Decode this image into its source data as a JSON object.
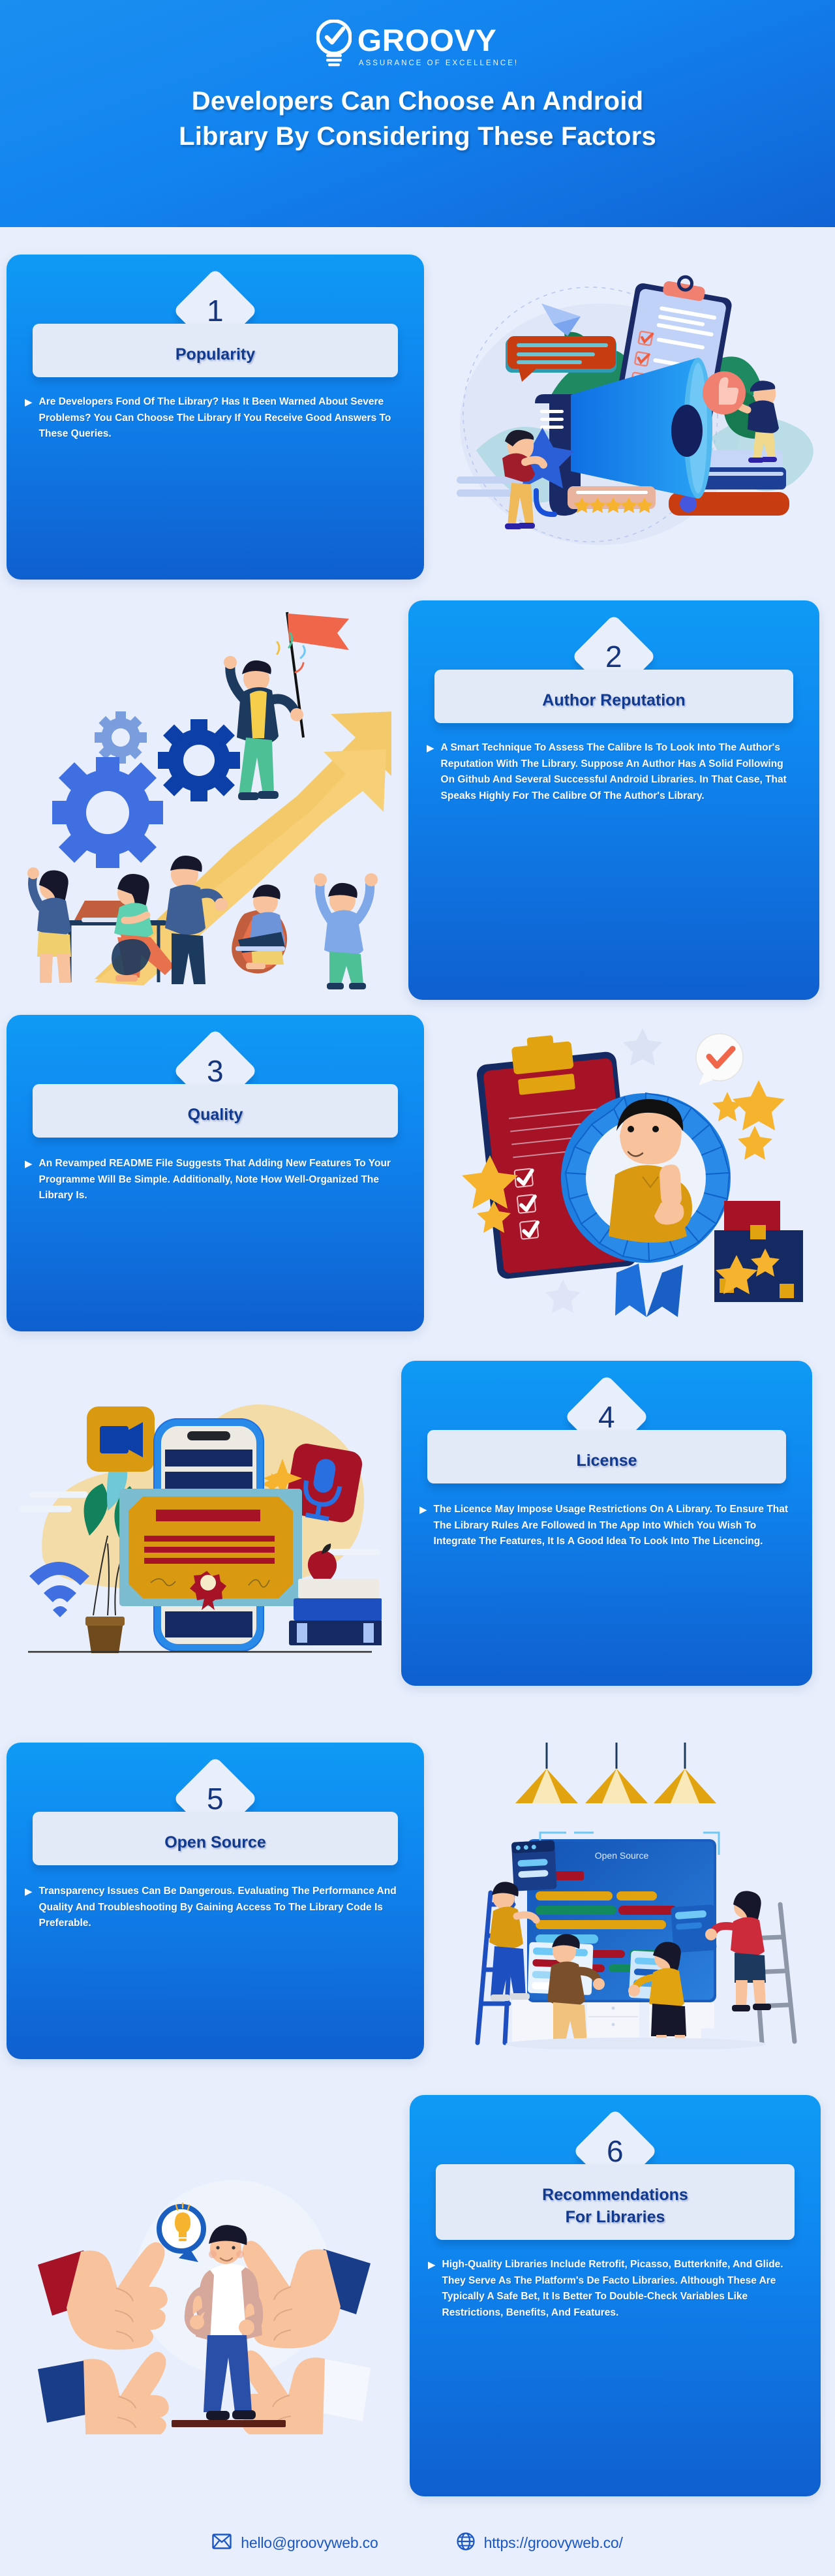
{
  "brand": {
    "logo_name": "GROOVY",
    "logo_tagline": "ASSURANCE OF EXCELLENCE!",
    "logo_icon": "lightbulb-check-icon",
    "accent_blue": "#0f86ef",
    "deep_blue": "#11398e",
    "page_bg": "#e8eefb"
  },
  "header": {
    "title_line1": "Developers Can Choose An Android",
    "title_line2": "Library By Considering These Factors"
  },
  "cards": [
    {
      "number": "1",
      "title": "Popularity",
      "title_line2": "",
      "body": "Are Developers Fond Of The Library? Has It Been Warned About Severe Problems? You Can Choose The Library If You Receive Good Answers To These Queries.",
      "bullet": "▶",
      "illustration": "megaphone-reviews-illustration",
      "side": "left"
    },
    {
      "number": "2",
      "title": "Author Reputation",
      "title_line2": "",
      "body": "A Smart Technique To Assess The Calibre Is To Look Into The Author's Reputation With The Library. Suppose An Author Has A Solid Following On Github And Several Successful Android Libraries. In That Case, That Speaks Highly For The Calibre Of The Author's Library.",
      "bullet": "▶",
      "illustration": "growth-teamwork-illustration",
      "side": "right"
    },
    {
      "number": "3",
      "title": "Quality",
      "title_line2": "",
      "body": " An Revamped README File Suggests That Adding New Features To Your Programme Will Be Simple. Additionally, Note How Well-Organized The Library Is.",
      "bullet": "▶",
      "illustration": "quality-badge-thumbsup-illustration",
      "side": "left"
    },
    {
      "number": "4",
      "title": "License",
      "title_line2": "",
      "body": "The Licence May Impose Usage Restrictions On A Library. To Ensure That The Library Rules Are Followed In The App Into Which You Wish To Integrate The Features, It Is A Good Idea To Look Into The Licencing.",
      "bullet": "▶",
      "illustration": "certificate-license-illustration",
      "side": "right"
    },
    {
      "number": "5",
      "title": "Open Source",
      "title_line2": "",
      "body": "Transparency Issues Can Be Dangerous. Evaluating The Performance And Quality And Troubleshooting By Gaining Access To The Library Code Is Preferable.",
      "bullet": "▶",
      "illustration": "open-source-building-illustration",
      "side": "left"
    },
    {
      "number": "6",
      "title": "Recommendations",
      "title_line2": "For Libraries",
      "body": "High-Quality Libraries Include Retrofit, Picasso, Butterknife, And Glide. They Serve As The Platform's De Facto Libraries. Although These Are Typically A Safe Bet, It Is Better To Double-Check Variables Like Restrictions, Benefits, And Features.",
      "bullet": "▶",
      "illustration": "thumbs-up-idea-illustration",
      "side": "right"
    }
  ],
  "illustration_labels": {
    "open_source_screen": "Open Source"
  },
  "footer": {
    "email": "hello@groovyweb.co",
    "email_icon": "envelope-icon",
    "website": "https://groovyweb.co/",
    "website_icon": "globe-icon"
  }
}
